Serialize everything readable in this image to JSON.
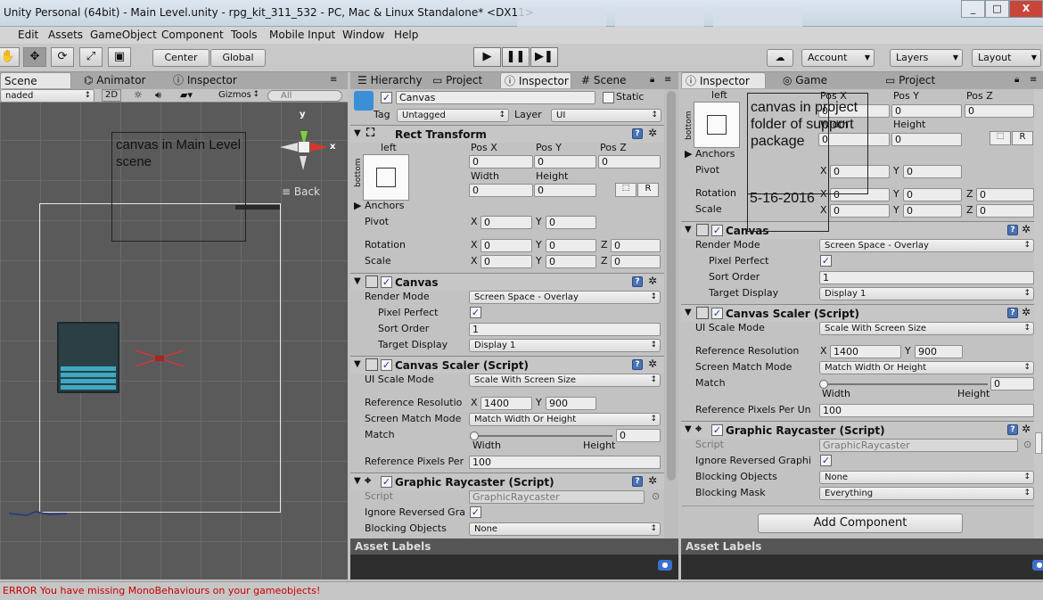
{
  "window": {
    "title": "Unity Personal (64bit) - Main Level.unity - rpg_kit_311_532 - PC, Mac & Linux Standalone* <DX11>",
    "minimize": "_",
    "maximize": "□",
    "close": "X"
  },
  "menu": [
    "Edit",
    "Assets",
    "GameObject",
    "Component",
    "Tools",
    "Mobile Input",
    "Window",
    "Help"
  ],
  "toolbar": {
    "tools": [
      "✋",
      "✥",
      "⟳",
      "⤢",
      "▣"
    ],
    "center": "Center",
    "global": "Global",
    "play": "▶",
    "pause": "❚❚",
    "step": "▶❚",
    "cloud": "☁",
    "account": "Account",
    "layers": "Layers",
    "layout": "Layout"
  },
  "scene_panel": {
    "tabs": [
      "Scene",
      "Animator",
      "Inspector"
    ],
    "shading": "naded",
    "mode2d": "2D",
    "gizmos": "Gizmos",
    "search_placeholder": "All",
    "back": "Back",
    "axis_y": "y",
    "axis_x": "x",
    "annotation": "canvas in Main Level scene"
  },
  "mid_panel": {
    "tabs": [
      "Hierarchy",
      "Project",
      "Inspector",
      "Scene"
    ]
  },
  "right_panel": {
    "tabs": [
      "Inspector",
      "Game",
      "Project"
    ]
  },
  "inspector_left": {
    "object_name": "Canvas",
    "static": "Static",
    "tag_label": "Tag",
    "tag": "Untagged",
    "layer_label": "Layer",
    "layer": "UI",
    "rect": {
      "title": "Rect Transform",
      "anchor_h": "left",
      "anchor_v": "bottom",
      "posx_l": "Pos X",
      "posy_l": "Pos Y",
      "posz_l": "Pos Z",
      "posx": "0",
      "posy": "0",
      "posz": "0",
      "width_l": "Width",
      "height_l": "Height",
      "width": "0",
      "height": "0",
      "r": "R",
      "anchors": "Anchors",
      "pivot": "Pivot",
      "pivot_x": "0",
      "pivot_y": "0",
      "rotation": "Rotation",
      "rot_x": "0",
      "rot_y": "0",
      "rot_z": "0",
      "scale": "Scale",
      "sc_x": "0",
      "sc_y": "0",
      "sc_z": "0",
      "x": "X",
      "y": "Y",
      "z": "Z"
    },
    "canvas": {
      "title": "Canvas",
      "render_mode_l": "Render Mode",
      "render_mode": "Screen Space - Overlay",
      "pixel_perfect_l": "Pixel Perfect",
      "sort_order_l": "Sort Order",
      "sort_order": "1",
      "target_display_l": "Target Display",
      "target_display": "Display 1"
    },
    "scaler": {
      "title": "Canvas Scaler (Script)",
      "ui_scale_l": "UI Scale Mode",
      "ui_scale": "Scale With Screen Size",
      "ref_res_l": "Reference Resolutio",
      "ref_x": "1400",
      "ref_y": "900",
      "match_mode_l": "Screen Match Mode",
      "match_mode": "Match Width Or Height",
      "match_l": "Match",
      "match_val": "0",
      "width": "Width",
      "height": "Height",
      "ppu_l": "Reference Pixels Per",
      "ppu": "100"
    },
    "raycaster": {
      "title": "Graphic Raycaster (Script)",
      "script_l": "Script",
      "script": "GraphicRaycaster",
      "ignore_l": "Ignore Reversed Gra",
      "blocking_l": "Blocking Objects",
      "blocking": "None"
    },
    "asset_labels": "Asset Labels"
  },
  "inspector_right": {
    "rect": {
      "anchor_h": "left",
      "anchor_v": "bottom",
      "posx_l": "Pos X",
      "posy_l": "Pos Y",
      "posz_l": "Pos Z",
      "posx": "0",
      "posy": "0",
      "posz": "0",
      "width_l": "Width",
      "height_l": "Height",
      "width": "0",
      "height": "0",
      "r": "R",
      "anchors": "Anchors",
      "pivot": "Pivot",
      "pivot_x": "0",
      "pivot_y": "0",
      "rotation": "Rotation",
      "rot_x": "0",
      "rot_y": "0",
      "rot_z": "0",
      "scale": "Scale",
      "sc_x": "0",
      "sc_y": "0",
      "sc_z": "0",
      "x": "X",
      "y": "Y",
      "z": "Z"
    },
    "canvas": {
      "title": "Canvas",
      "render_mode_l": "Render Mode",
      "render_mode": "Screen Space - Overlay",
      "pixel_perfect_l": "Pixel Perfect",
      "sort_order_l": "Sort Order",
      "sort_order": "1",
      "target_display_l": "Target Display",
      "target_display": "Display 1"
    },
    "scaler": {
      "title": "Canvas Scaler (Script)",
      "ui_scale_l": "UI Scale Mode",
      "ui_scale": "Scale With Screen Size",
      "ref_res_l": "Reference Resolution",
      "ref_x": "1400",
      "ref_y": "900",
      "match_mode_l": "Screen Match Mode",
      "match_mode": "Match Width Or Height",
      "match_l": "Match",
      "match_val": "0",
      "width": "Width",
      "height": "Height",
      "ppu_l": "Reference Pixels Per Un",
      "ppu": "100"
    },
    "raycaster": {
      "title": "Graphic Raycaster (Script)",
      "script_l": "Script",
      "script": "GraphicRaycaster",
      "ignore_l": "Ignore Reversed Graphi",
      "blocking_l": "Blocking Objects",
      "blocking": "None",
      "mask_l": "Blocking Mask",
      "mask": "Everything"
    },
    "add_component": "Add Component",
    "asset_labels": "Asset Labels",
    "annotation": "canvas in project folder of support package",
    "annotation_date": "5-16-2016"
  },
  "status": {
    "error": "ERROR You have missing MonoBehaviours on your gameobjects!"
  }
}
